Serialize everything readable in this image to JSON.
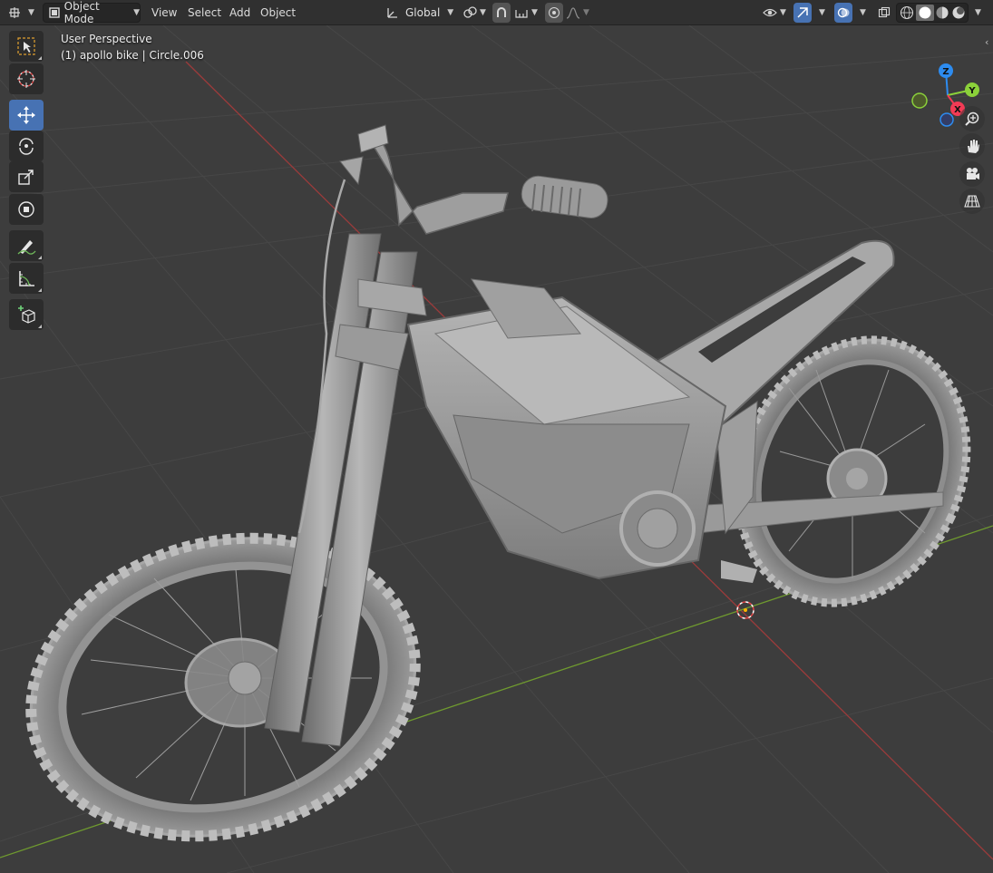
{
  "header": {
    "editor_type_icon": "3d-viewport-icon",
    "mode": {
      "icon": "object-mode-icon",
      "label": "Object Mode"
    },
    "menus": [
      "View",
      "Select",
      "Add",
      "Object"
    ],
    "transform_orientation": {
      "icon": "orientation-axes-icon",
      "label": "Global"
    },
    "pivot_icon": "pivot-point-icon",
    "snap_icon": "snap-magnet-icon",
    "snap_target_icon": "snap-increment-icon",
    "proportional_edit_icon": "proportional-edit-icon",
    "falloff_icon": "falloff-curve-icon",
    "right_icons": [
      "visibility-eye-icon",
      "gizmo-toggle-icon",
      "overlay-toggle-icon",
      "xray-icon",
      "shading-wireframe-icon",
      "shading-solid-icon",
      "shading-material-icon",
      "shading-rendered-icon"
    ]
  },
  "viewport": {
    "title": "User Perspective",
    "object_info": "(1) apollo bike | Circle.006",
    "background": "#3d3d3d",
    "grid_color": "#4a4a4a",
    "x_axis_color": "#9c3b3b",
    "y_axis_color": "#6f9a2f",
    "model_color": "#9a9a9a"
  },
  "toolbar": {
    "tools": [
      {
        "name": "select-box-icon",
        "active": false
      },
      {
        "name": "cursor-icon",
        "active": false
      },
      {
        "name": "move-icon",
        "active": true
      },
      {
        "name": "rotate-icon",
        "active": false
      },
      {
        "name": "scale-icon",
        "active": false
      },
      {
        "name": "transform-icon",
        "active": false
      },
      {
        "name": "annotate-icon",
        "active": false
      },
      {
        "name": "measure-icon",
        "active": false
      },
      {
        "name": "add-cube-icon",
        "active": false
      }
    ]
  },
  "gizmo": {
    "z": "Z",
    "y": "Y",
    "x": "X",
    "colors": {
      "x": "#f33b55",
      "y": "#8bd13a",
      "z": "#2d8cf0"
    }
  },
  "navigation": {
    "buttons": [
      "zoom-icon",
      "pan-hand-icon",
      "camera-icon",
      "perspective-grid-icon"
    ]
  }
}
